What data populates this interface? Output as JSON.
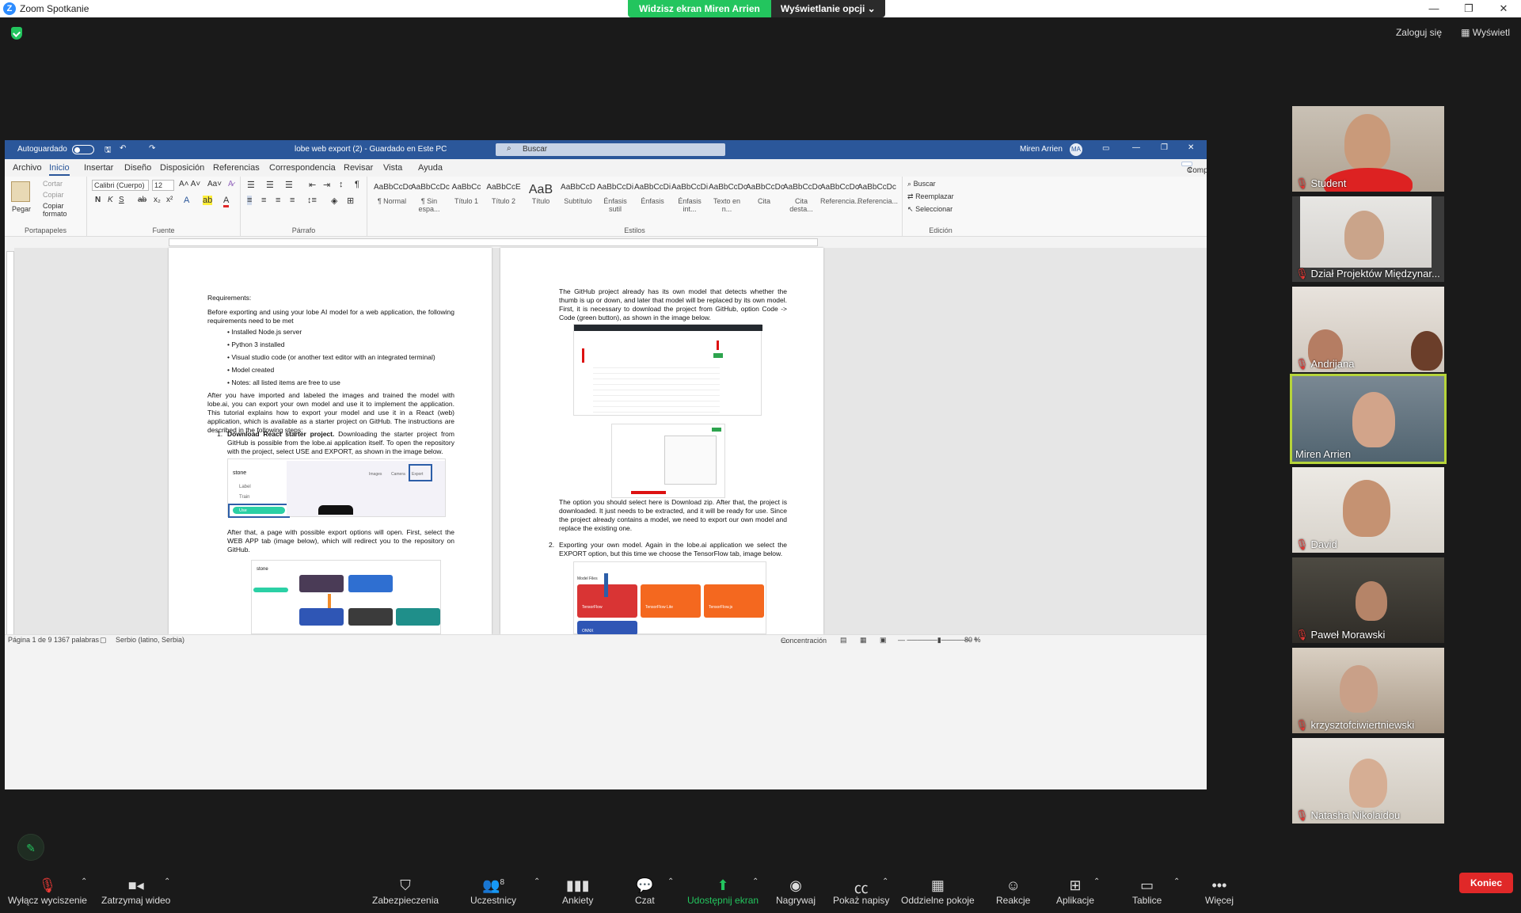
{
  "zoom": {
    "app_title": "Zoom Spotkanie",
    "share_banner": {
      "viewing": "Widzisz ekran Miren Arrien",
      "options": "Wyświetlanie opcji"
    },
    "login": "Zaloguj się",
    "view": "Wyświetl",
    "participants": [
      {
        "name": "Student"
      },
      {
        "name": "Dział Projektów Międzynar..."
      },
      {
        "name": "Andrijana"
      },
      {
        "name": "Miren Arrien"
      },
      {
        "name": "David"
      },
      {
        "name": "Paweł Morawski"
      },
      {
        "name": "krzysztofciwiertniewski"
      },
      {
        "name": "Natasha Nikolaidou"
      }
    ],
    "toolbar": {
      "mute": "Wyłącz wyciszenie",
      "video": "Zatrzymaj wideo",
      "security": "Zabezpieczenia",
      "participants": "Uczestnicy",
      "participants_count": "8",
      "polls": "Ankiety",
      "chat": "Czat",
      "share": "Udostępnij ekran",
      "record": "Nagrywaj",
      "captions": "Pokaż napisy",
      "breakout": "Oddzielne pokoje",
      "reactions": "Reakcje",
      "apps": "Aplikacje",
      "whiteboards": "Tablice",
      "more": "Więcej",
      "end": "Koniec"
    },
    "colors": {
      "accent_green": "#23c55e",
      "end_red": "#e02828",
      "word_blue": "#2b579a"
    }
  },
  "word": {
    "autosave": "Autoguardado",
    "doc_title": "lobe web export (2) - Guardado en Este PC",
    "search": "Buscar",
    "user": "Miren Arrien",
    "user_initials": "MA",
    "menus": [
      "Archivo",
      "Inicio",
      "Insertar",
      "Diseño",
      "Disposición",
      "Referencias",
      "Correspondencia",
      "Revisar",
      "Vista",
      "Ayuda"
    ],
    "share": "Compartir",
    "ribbon": {
      "paste": "Pegar",
      "cut": "Cortar",
      "copy": "Copiar",
      "format_painter": "Copiar formato",
      "clipboard": "Portapapeles",
      "font_name": "Calibri (Cuerpo)",
      "font_size": "12",
      "font": "Fuente",
      "paragraph": "Párrafo",
      "styles_caption": "Estilos",
      "editing": "Edición",
      "find": "Buscar",
      "replace": "Reemplazar",
      "select": "Seleccionar",
      "styles": [
        {
          "sample": "AaBbCcDc",
          "name": "¶ Normal"
        },
        {
          "sample": "AaBbCcDc",
          "name": "¶ Sin espa..."
        },
        {
          "sample": "AaBbCc",
          "name": "Título 1"
        },
        {
          "sample": "AaBbCcE",
          "name": "Título 2"
        },
        {
          "sample": "AaB",
          "name": "Título"
        },
        {
          "sample": "AaBbCcD",
          "name": "Subtítulo"
        },
        {
          "sample": "AaBbCcDi",
          "name": "Énfasis sutil"
        },
        {
          "sample": "AaBbCcDi",
          "name": "Énfasis"
        },
        {
          "sample": "AaBbCcDi",
          "name": "Énfasis int..."
        },
        {
          "sample": "AaBbCcDc",
          "name": "Texto en n..."
        },
        {
          "sample": "AaBbCcDc",
          "name": "Cita"
        },
        {
          "sample": "AaBbCcDc",
          "name": "Cita desta..."
        },
        {
          "sample": "AaBbCcDc",
          "name": "Referencia..."
        },
        {
          "sample": "AaBbCcDc",
          "name": "Referencia..."
        }
      ]
    },
    "page1": {
      "heading": "Requirements:",
      "intro": "Before exporting and using your lobe AI model for a web application, the following requirements need to be met",
      "bullets": [
        "• Installed Node.js server",
        "• Python 3 installed",
        "• Visual studio code (or another text editor with an integrated terminal)",
        "• Model created",
        "• Notes: all listed items are free to use"
      ],
      "para": "After you have imported and labeled the images and trained the model with lobe.ai, you can export your own model and use it to implement the application. This tutorial explains how to export your model and use it in a React (web) application, which is available as a starter project on GitHub. The instructions are described in the following steps:",
      "step1_num": "1.",
      "step1_bold": "Download React starter project.",
      "step1_text": " Downloading the starter project from GitHub is possible from the lobe.ai application itself. To open the repository with the project, select USE and EXPORT, as shown in the image below.",
      "after_text": "After that, a page with possible export options will open. First, select the WEB APP tab (image below), which will redirect you to the repository on GitHub.",
      "shot1_app": "stone",
      "shot1_label": "Label",
      "shot1_train": "Train",
      "shot1_use": "Use",
      "shot1_images": "Images",
      "shot1_camera": "Camera",
      "shot1_export": "Export",
      "shot2_app": "stone"
    },
    "page2": {
      "para1": "The GitHub project already has its own model that detects whether the thumb is up or down, and later that model will be replaced by its own model. First, it is necessary to download the project from GitHub, option Code -> Code (green button), as shown in the image below.",
      "para2": "The option you should select here is Download zip. After that, the project is downloaded. It just needs to be extracted, and it will be ready for use. Since the project already contains a model, we need to export our own model and replace the existing one.",
      "step2_num": "2.",
      "step2": "Exporting your own model. Again in the lobe.ai application we select the EXPORT option, but this time we choose the TensorFlow tab, image below.",
      "model_files": "Model Files",
      "tf": "TensorFlow",
      "tflite": "TensorFlow Lite",
      "tfjs": "TensorFlow.js",
      "onnx": "ONNX"
    },
    "status": {
      "page": "Página 1 de 9",
      "words": "1367 palabras",
      "language": "Serbio (latino, Serbia)",
      "focus": "Concentración",
      "zoom": "80 %"
    }
  }
}
